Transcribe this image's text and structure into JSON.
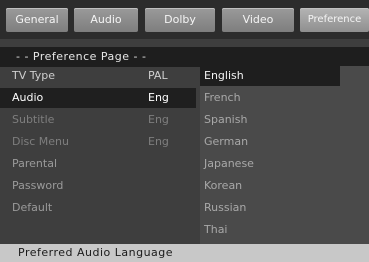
{
  "tabs": [
    {
      "label": "General"
    },
    {
      "label": "Audio"
    },
    {
      "label": "Dolby"
    },
    {
      "label": "Video"
    },
    {
      "label": "Preference"
    }
  ],
  "page_header": "- - Preference Page - -",
  "settings": [
    {
      "label": "TV Type",
      "value": "PAL"
    },
    {
      "label": "Audio",
      "value": "Eng"
    },
    {
      "label": "Subtitle",
      "value": "Eng"
    },
    {
      "label": "Disc Menu",
      "value": "Eng"
    },
    {
      "label": "Parental",
      "value": ""
    },
    {
      "label": "Password",
      "value": ""
    },
    {
      "label": "Default",
      "value": ""
    }
  ],
  "options": [
    {
      "label": "English"
    },
    {
      "label": "French"
    },
    {
      "label": "Spanish"
    },
    {
      "label": "German"
    },
    {
      "label": "Japanese"
    },
    {
      "label": "Korean"
    },
    {
      "label": "Russian"
    },
    {
      "label": "Thai"
    }
  ],
  "footer": "Preferred Audio Language"
}
